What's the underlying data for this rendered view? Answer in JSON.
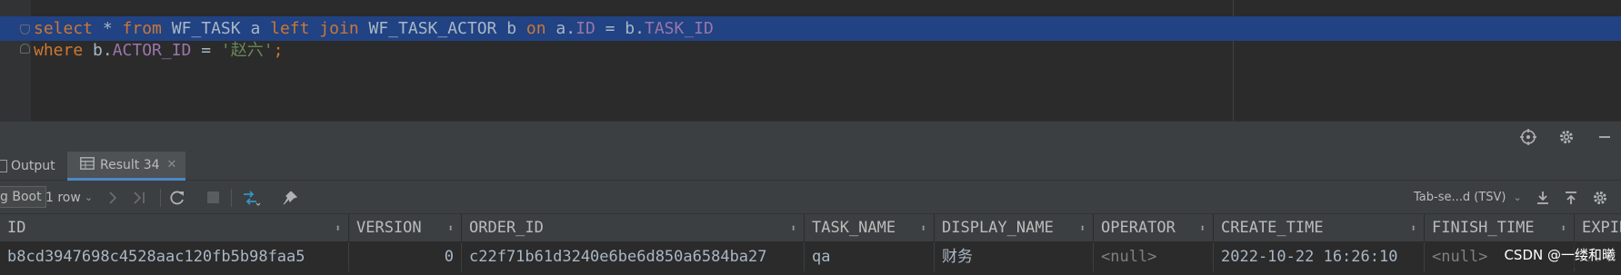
{
  "editor": {
    "line1": [
      {
        "t": "select",
        "c": "kw"
      },
      {
        "t": " * ",
        "c": "plain"
      },
      {
        "t": "from",
        "c": "kw"
      },
      {
        "t": " WF_TASK a ",
        "c": "plain"
      },
      {
        "t": "left join",
        "c": "kw"
      },
      {
        "t": " WF_TASK_ACTOR b ",
        "c": "plain"
      },
      {
        "t": "on",
        "c": "kw"
      },
      {
        "t": " a.",
        "c": "plain"
      },
      {
        "t": "ID",
        "c": "col"
      },
      {
        "t": " = b.",
        "c": "plain"
      },
      {
        "t": "TASK_ID",
        "c": "col"
      }
    ],
    "line2": [
      {
        "t": "where",
        "c": "kw"
      },
      {
        "t": " b.",
        "c": "plain"
      },
      {
        "t": "ACTOR_ID",
        "c": "col"
      },
      {
        "t": " = ",
        "c": "plain"
      },
      {
        "t": "'赵六'",
        "c": "str"
      },
      {
        "t": ";",
        "c": "kw"
      }
    ]
  },
  "tabs": {
    "output_label": "Output",
    "result_label": "Result 34"
  },
  "toolbar": {
    "session_label": "g Boot",
    "rows_label": "1 row",
    "export_format": "Tab-se...d (TSV)"
  },
  "grid": {
    "columns": [
      "ID",
      "VERSION",
      "ORDER_ID",
      "TASK_NAME",
      "DISPLAY_NAME",
      "OPERATOR",
      "CREATE_TIME",
      "FINISH_TIME",
      "EXPIR"
    ],
    "row": {
      "ID": "b8cd3947698c4528aac120fb5b98faa5",
      "VERSION": "0",
      "ORDER_ID": "c22f71b61d3240e6be6d850a6584ba27",
      "TASK_NAME": "qa",
      "DISPLAY_NAME": "财务",
      "OPERATOR": "<null>",
      "CREATE_TIME": "2022-10-22 16:26:10",
      "FINISH_TIME": "<null>",
      "EXPIR": "ll"
    }
  },
  "watermark": "CSDN @一缕和曦",
  "colors": {
    "selection": "#214283",
    "keyword": "#cc7832",
    "column": "#9876aa",
    "string": "#6a8759",
    "background": "#2b2b2b",
    "panel": "#3c3f41"
  },
  "icons": [
    "gear-icon",
    "minimize-icon",
    "crosshair-icon",
    "table-icon",
    "refresh-icon",
    "stop-icon",
    "transaction-icon",
    "pin-icon",
    "download-icon",
    "upload-icon",
    "settings-icon",
    "next-icon",
    "last-icon",
    "close-icon",
    "output-icon"
  ]
}
